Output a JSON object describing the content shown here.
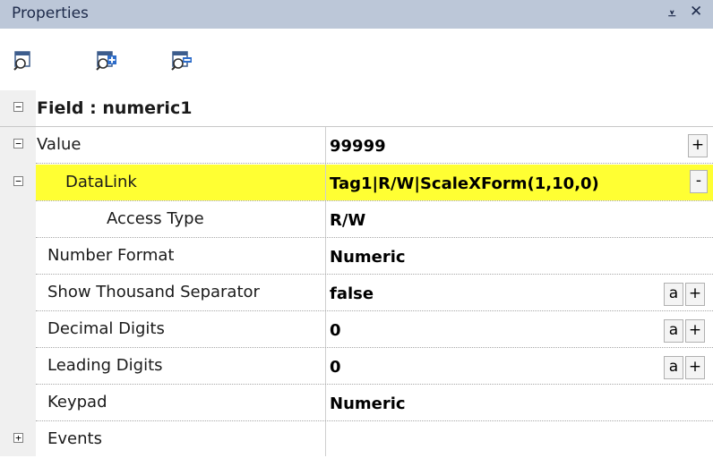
{
  "panel": {
    "title": "Properties",
    "pin_glyph": "⩡",
    "close_glyph": "✕"
  },
  "toolbar": {
    "buttons": [
      {
        "icon": "property-view-icon"
      },
      {
        "icon": "add-property-icon"
      },
      {
        "icon": "remove-property-icon"
      }
    ]
  },
  "grid": {
    "header": {
      "label": "Field : numeric1",
      "expander": "−"
    },
    "rows": [
      {
        "name": "Value",
        "value": "99999",
        "expander": "−",
        "buttons": [
          "+"
        ]
      },
      {
        "name": "DataLink",
        "value": "Tag1|R/W|ScaleXForm(1,10,0)",
        "expander": "−",
        "highlight": "#ffff33",
        "buttons": [
          "-"
        ]
      },
      {
        "name": "Access Type",
        "value": "R/W"
      },
      {
        "name": "Number Format",
        "value": "Numeric"
      },
      {
        "name": "Show Thousand Separator",
        "value": "false",
        "buttons": [
          "a",
          "+"
        ]
      },
      {
        "name": "Decimal Digits",
        "value": "0",
        "buttons": [
          "a",
          "+"
        ]
      },
      {
        "name": "Leading Digits",
        "value": "0",
        "buttons": [
          "a",
          "+"
        ]
      },
      {
        "name": "Keypad",
        "value": "Numeric"
      },
      {
        "name": "Events",
        "value": "",
        "expander": "+"
      }
    ]
  },
  "colors": {
    "title_bar": "#bcc7d8",
    "highlight": "#ffff33",
    "gutter": "#f0f0f0"
  }
}
